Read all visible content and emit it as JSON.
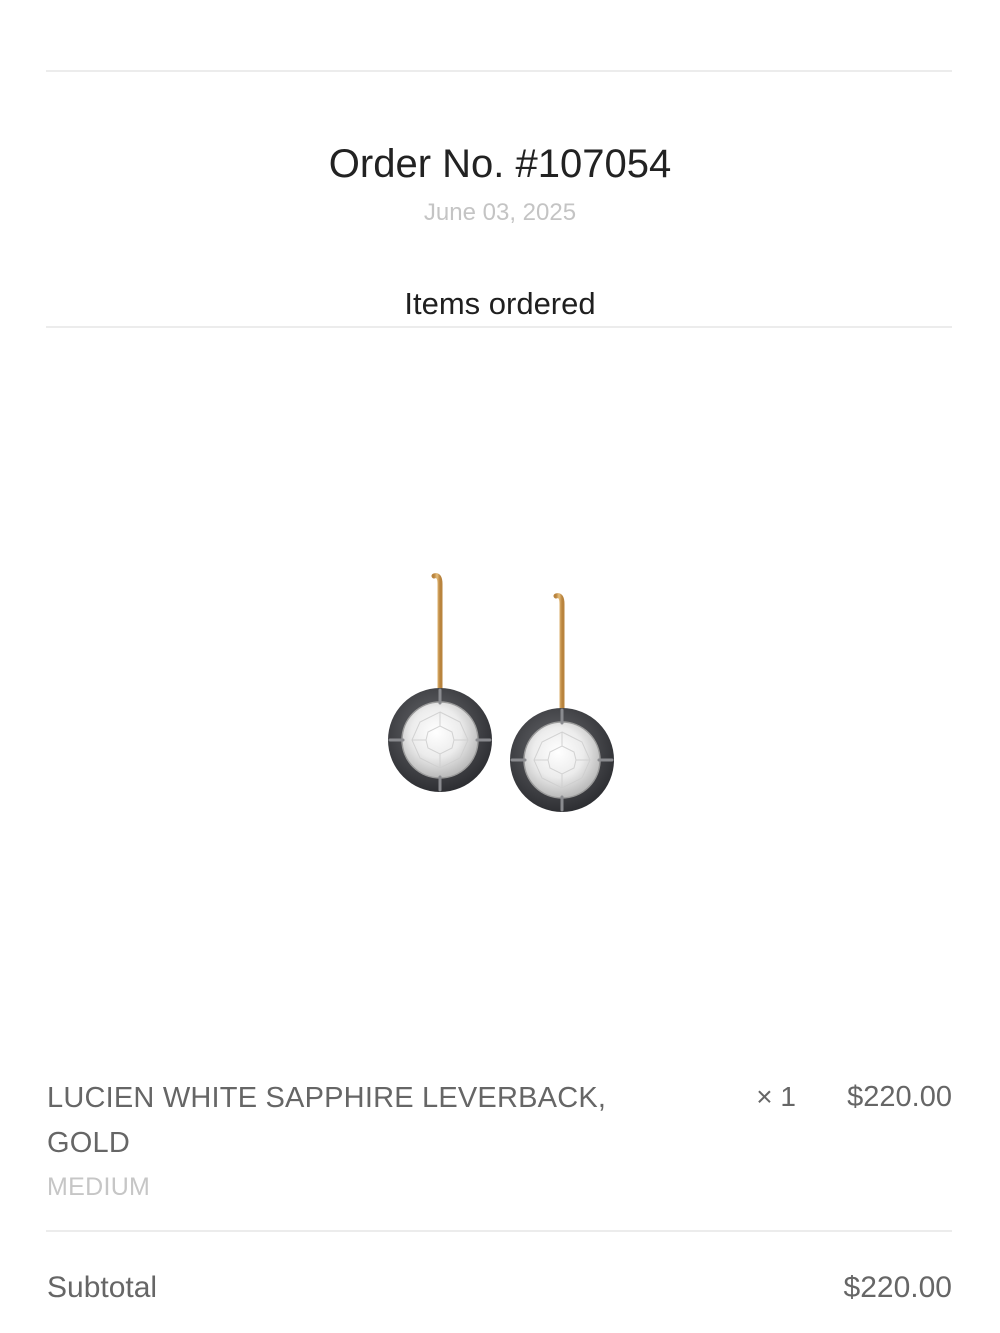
{
  "order": {
    "title": "Order No. #107054",
    "date": "June 03, 2025"
  },
  "items_section": {
    "heading": "Items ordered"
  },
  "items": [
    {
      "name": "LUCIEN WHITE SAPPHIRE LEVERBACK, GOLD",
      "variant": "MEDIUM",
      "quantity": "× 1",
      "price": "$220.00",
      "image_icon": "earrings-product-image"
    }
  ],
  "summary": {
    "subtotal_label": "Subtotal",
    "subtotal_value": "$220.00"
  },
  "colors": {
    "text_primary": "#222222",
    "text_secondary": "#666666",
    "text_muted": "#c4c4c4",
    "divider": "#ececec",
    "gold": "#d4a45a",
    "oxidized_bezel": "#4a4b4f"
  }
}
